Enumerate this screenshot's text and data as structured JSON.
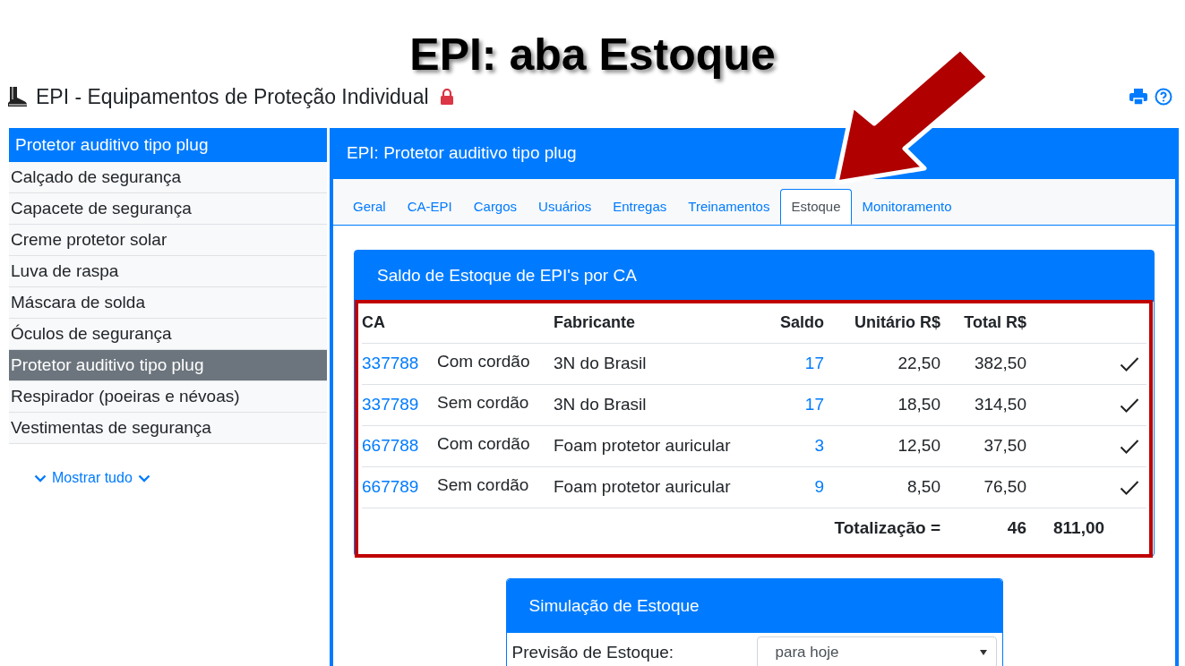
{
  "slide_title": "EPI: aba Estoque",
  "header": {
    "title": "EPI - Equipamentos de Proteção Individual",
    "locked": true
  },
  "sidebar": {
    "header": "Protetor auditivo tipo plug",
    "items": [
      {
        "label": "Calçado de segurança",
        "selected": false
      },
      {
        "label": "Capacete de segurança",
        "selected": false
      },
      {
        "label": "Creme protetor solar",
        "selected": false
      },
      {
        "label": "Luva de raspa",
        "selected": false
      },
      {
        "label": "Máscara de solda",
        "selected": false
      },
      {
        "label": "Óculos de segurança",
        "selected": false
      },
      {
        "label": "Protetor auditivo tipo plug",
        "selected": true
      },
      {
        "label": "Respirador (poeiras e névoas)",
        "selected": false
      },
      {
        "label": "Vestimentas de segurança",
        "selected": false
      }
    ],
    "show_all": "Mostrar tudo"
  },
  "panel_title": "EPI: Protetor auditivo tipo plug",
  "tabs": [
    {
      "label": "Geral",
      "selected": false
    },
    {
      "label": "CA-EPI",
      "selected": false
    },
    {
      "label": "Cargos",
      "selected": false
    },
    {
      "label": "Usuários",
      "selected": false
    },
    {
      "label": "Entregas",
      "selected": false
    },
    {
      "label": "Treinamentos",
      "selected": false
    },
    {
      "label": "Estoque",
      "selected": true
    },
    {
      "label": "Monitoramento",
      "selected": false
    }
  ],
  "stock_card": {
    "title": "Saldo de Estoque de EPI's por CA",
    "columns": [
      "CA",
      "Fabricante",
      "Saldo",
      "Unitário R$",
      "Total R$"
    ],
    "rows": [
      {
        "ca": "337788",
        "variant": "Com cordão",
        "manufacturer": "3N do Brasil",
        "balance": "17",
        "unit": "22,50",
        "total": "382,50",
        "checked": true
      },
      {
        "ca": "337789",
        "variant": "Sem cordão",
        "manufacturer": "3N do Brasil",
        "balance": "17",
        "unit": "18,50",
        "total": "314,50",
        "checked": true
      },
      {
        "ca": "667788",
        "variant": "Com cordão",
        "manufacturer": "Foam protetor auricular",
        "balance": "3",
        "unit": "12,50",
        "total": "37,50",
        "checked": true
      },
      {
        "ca": "667789",
        "variant": "Sem cordão",
        "manufacturer": "Foam protetor auricular",
        "balance": "9",
        "unit": "8,50",
        "total": "76,50",
        "checked": true
      }
    ],
    "totals": {
      "label": "Totalização =",
      "balance": "46",
      "total": "811,00"
    }
  },
  "simulation": {
    "title": "Simulação de Estoque",
    "label": "Previsão de Estoque:",
    "value": "para hoje"
  }
}
